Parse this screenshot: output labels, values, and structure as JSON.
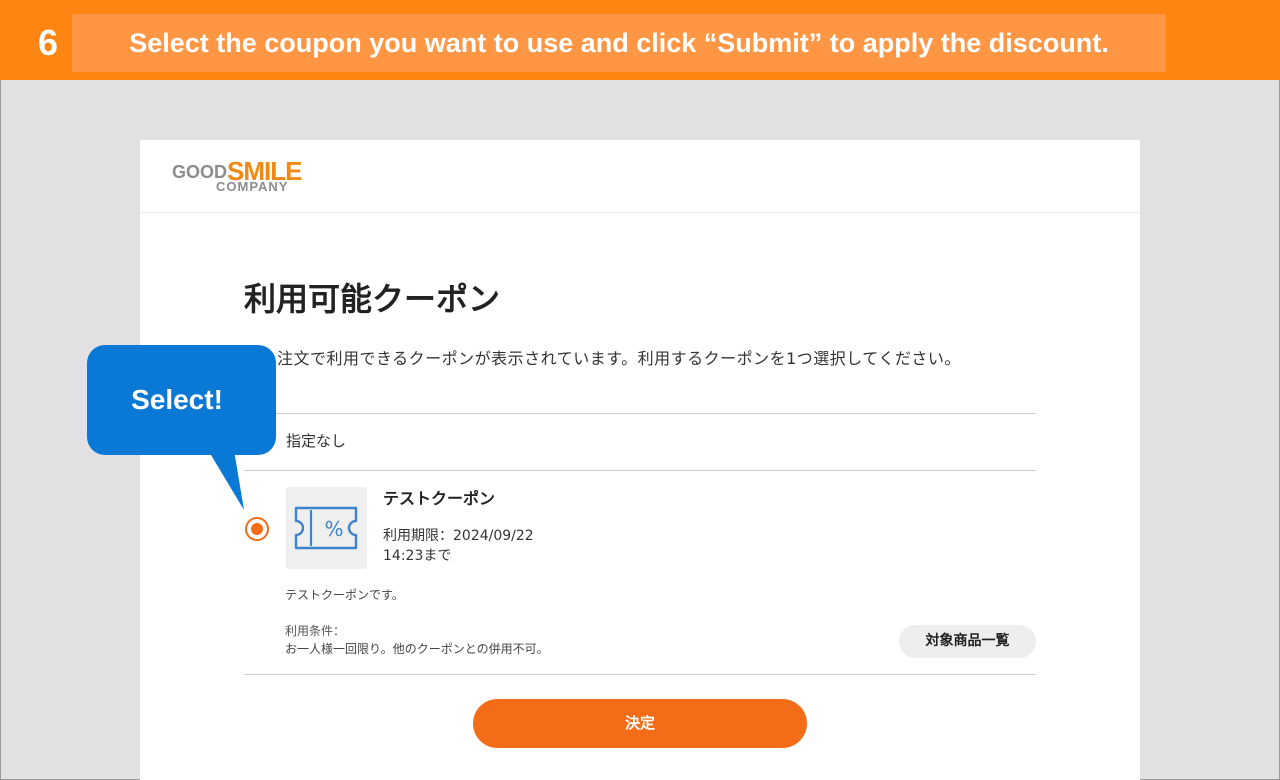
{
  "banner": {
    "step": "6",
    "instruction": "Select the coupon you want to use and click “Submit” to apply the discount."
  },
  "logo": {
    "word1": "GOOD",
    "word2": "SMILE",
    "word3": "COMPANY"
  },
  "page": {
    "title": "利用可能クーポン",
    "description": "この注文で利用できるクーポンが表示されています。利用するクーポンを1つ選択してください。"
  },
  "options": {
    "none_label": "指定なし",
    "coupon": {
      "name": "テストクーポン",
      "expiry": "利用期限：2024/09/22",
      "expiry_time": "14:23まで",
      "description": "テストクーポンです。",
      "conditions_label": "利用条件：",
      "conditions_text": "お一人様一回限り。他のクーポンとの併用不可。",
      "products_button": "対象商品一覧",
      "icon": "coupon-percent-icon",
      "selected": true
    }
  },
  "submit_label": "決定",
  "callout": {
    "text": "Select!"
  },
  "colors": {
    "banner": "#ff8512",
    "accent": "#f36c17",
    "callout": "#0a79d6",
    "coupon_icon": "#3d84cc"
  }
}
